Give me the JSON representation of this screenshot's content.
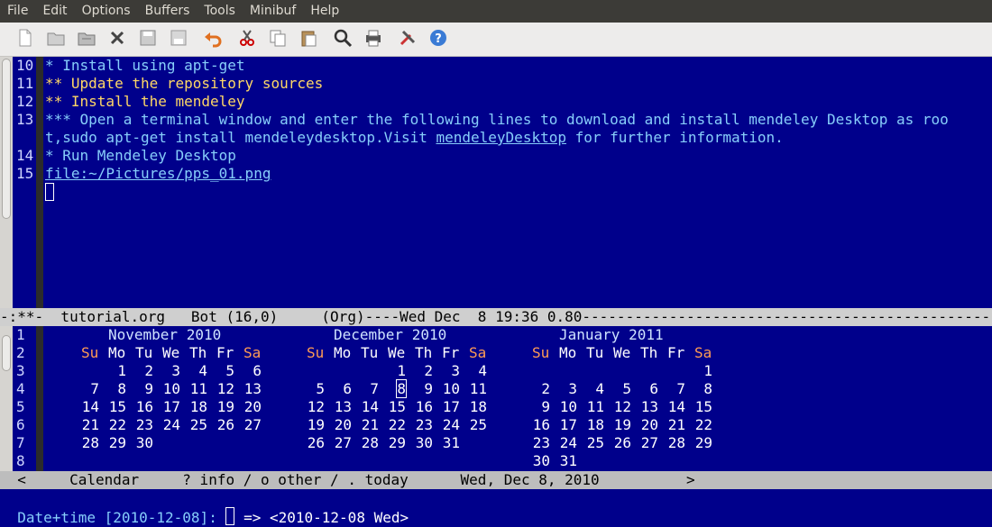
{
  "menu": [
    "File",
    "Edit",
    "Options",
    "Buffers",
    "Tools",
    "Minibuf",
    "Help"
  ],
  "toolbar": [
    {
      "name": "new-file-icon"
    },
    {
      "name": "open-file-icon"
    },
    {
      "name": "open-directory-icon"
    },
    {
      "name": "close-buffer-icon"
    },
    {
      "name": "save-icon"
    },
    {
      "name": "save-as-icon"
    },
    {
      "name": "undo-icon"
    },
    {
      "name": "cut-icon"
    },
    {
      "name": "copy-icon"
    },
    {
      "name": "paste-icon"
    },
    {
      "name": "search-icon"
    },
    {
      "name": "print-icon"
    },
    {
      "name": "preferences-icon"
    },
    {
      "name": "help-icon"
    }
  ],
  "editor": {
    "lines": [
      {
        "n": "10",
        "text": "* Install using apt-get",
        "level": 1
      },
      {
        "n": "11",
        "text": "** Update the repository sources",
        "level": 2
      },
      {
        "n": "12",
        "text": "** Install the mendeley",
        "level": 2
      },
      {
        "n": "13",
        "text": "*** Open a terminal window and enter the following lines to download and install mendeley Desktop as roo",
        "level": 3
      },
      {
        "n": "",
        "text_before": "t,sudo apt-get install mendeleydesktop.Visit ",
        "link": "mendeleyDesktop",
        "text_after": " for further information.",
        "level": 3
      },
      {
        "n": "14",
        "text": "* Run Mendeley Desktop",
        "level": 1
      },
      {
        "n": "15",
        "link_only": "file:~/Pictures/pps_01.png"
      }
    ]
  },
  "modeline": "-:**-  tutorial.org   Bot (16,0)     (Org)----Wed Dec  8 19:36 0.80------------------------------------------------",
  "calendar": {
    "line_numbers": [
      "1",
      "2",
      "3",
      "4",
      "5",
      "6",
      "7",
      "8"
    ],
    "months": [
      {
        "title": "November 2010",
        "weekdays": [
          "Su",
          "Mo",
          "Tu",
          "We",
          "Th",
          "Fr",
          "Sa"
        ],
        "weeks": [
          [
            "",
            "1",
            "2",
            "3",
            "4",
            "5",
            "6"
          ],
          [
            "7",
            "8",
            "9",
            "10",
            "11",
            "12",
            "13"
          ],
          [
            "14",
            "15",
            "16",
            "17",
            "18",
            "19",
            "20"
          ],
          [
            "21",
            "22",
            "23",
            "24",
            "25",
            "26",
            "27"
          ],
          [
            "28",
            "29",
            "30",
            "",
            "",
            "",
            ""
          ]
        ]
      },
      {
        "title": "December 2010",
        "weekdays": [
          "Su",
          "Mo",
          "Tu",
          "We",
          "Th",
          "Fr",
          "Sa"
        ],
        "weeks": [
          [
            "",
            "",
            "",
            "1",
            "2",
            "3",
            "4"
          ],
          [
            "5",
            "6",
            "7",
            "8",
            "9",
            "10",
            "11"
          ],
          [
            "12",
            "13",
            "14",
            "15",
            "16",
            "17",
            "18"
          ],
          [
            "19",
            "20",
            "21",
            "22",
            "23",
            "24",
            "25"
          ],
          [
            "26",
            "27",
            "28",
            "29",
            "30",
            "31",
            ""
          ]
        ]
      },
      {
        "title": "January 2011",
        "weekdays": [
          "Su",
          "Mo",
          "Tu",
          "We",
          "Th",
          "Fr",
          "Sa"
        ],
        "weeks": [
          [
            "",
            "",
            "",
            "",
            "",
            "",
            "1"
          ],
          [
            "2",
            "3",
            "4",
            "5",
            "6",
            "7",
            "8"
          ],
          [
            "9",
            "10",
            "11",
            "12",
            "13",
            "14",
            "15"
          ],
          [
            "16",
            "17",
            "18",
            "19",
            "20",
            "21",
            "22"
          ],
          [
            "23",
            "24",
            "25",
            "26",
            "27",
            "28",
            "29"
          ],
          [
            "30",
            "31",
            "",
            "",
            "",
            "",
            ""
          ]
        ]
      }
    ],
    "today": "8",
    "modeline": "  <     Calendar     ? info / o other / . today      Wed, Dec 8, 2010          >"
  },
  "minibuffer": {
    "prompt": "Date+time [2010-12-08]: ",
    "suffix": " => <2010-12-08 Wed>"
  }
}
